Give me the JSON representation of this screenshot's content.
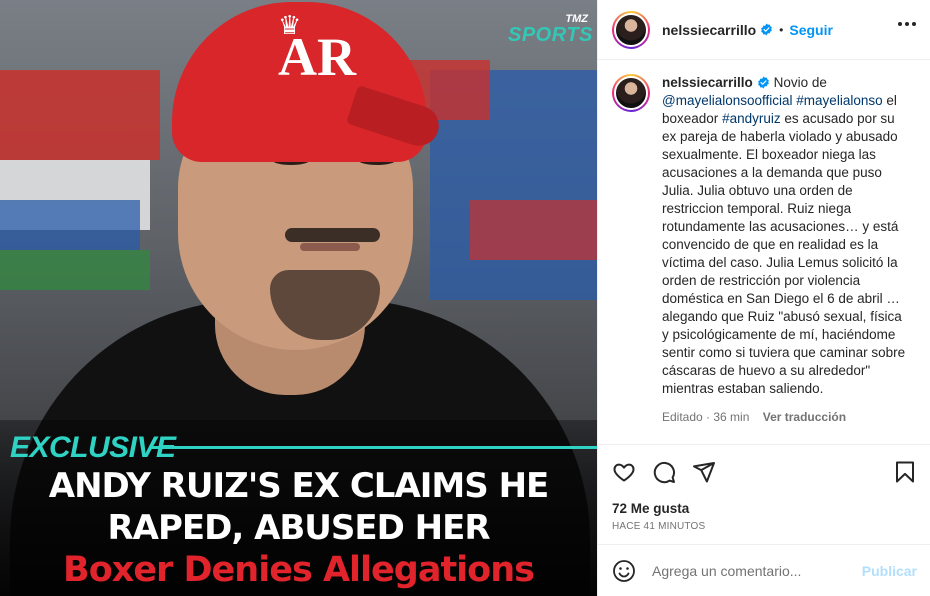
{
  "media": {
    "brand_top": "TMZ",
    "brand_bottom": "SPORTS",
    "cap_logo": "AR",
    "exclusive": "EXCLUSIVE",
    "headline_line1": "ANDY RUIZ'S EX CLAIMS HE",
    "headline_line2": "RAPED, ABUSED HER",
    "headline_line3": "Boxer Denies Allegations"
  },
  "header": {
    "username": "nelssiecarrillo",
    "separator": "•",
    "follow_label": "Seguir"
  },
  "caption": {
    "username": "nelssiecarrillo",
    "text_before_mention": "Novio de",
    "mention": "@mayelialonsoofficial",
    "hashtag1": "#mayelialonso",
    "text_before_hashtag2": "el boxeador",
    "hashtag2": "#andyruiz",
    "text_rest": "es acusado por su ex pareja de haberla violado y abusado sexualmente. El boxeador niega las acusaciones a la demanda que puso Julia. Julia obtuvo una orden de restriccion temporal. Ruiz niega rotundamente las acusaciones… y está convencido de que en realidad es la víctima del caso. Julia Lemus solicitó la orden de restricción por violencia doméstica en San Diego el 6 de abril … alegando que Ruiz \"abusó sexual, física y psicológicamente de mí, haciéndome sentir como si tuviera que caminar sobre cáscaras de huevo a su alrededor\" mientras estaban saliendo.",
    "edited": "Editado · 36 min",
    "translate": "Ver traducción"
  },
  "engagement": {
    "likes": "72 Me gusta",
    "time_ago": "HACE 41 MINUTOS"
  },
  "comment_box": {
    "placeholder": "Agrega un comentario...",
    "publish": "Publicar"
  },
  "colors": {
    "accent": "#0095f6",
    "publish_disabled": "#b2dffc",
    "headline_red": "#e1242b",
    "exclusive_teal": "#2fd3c4"
  }
}
